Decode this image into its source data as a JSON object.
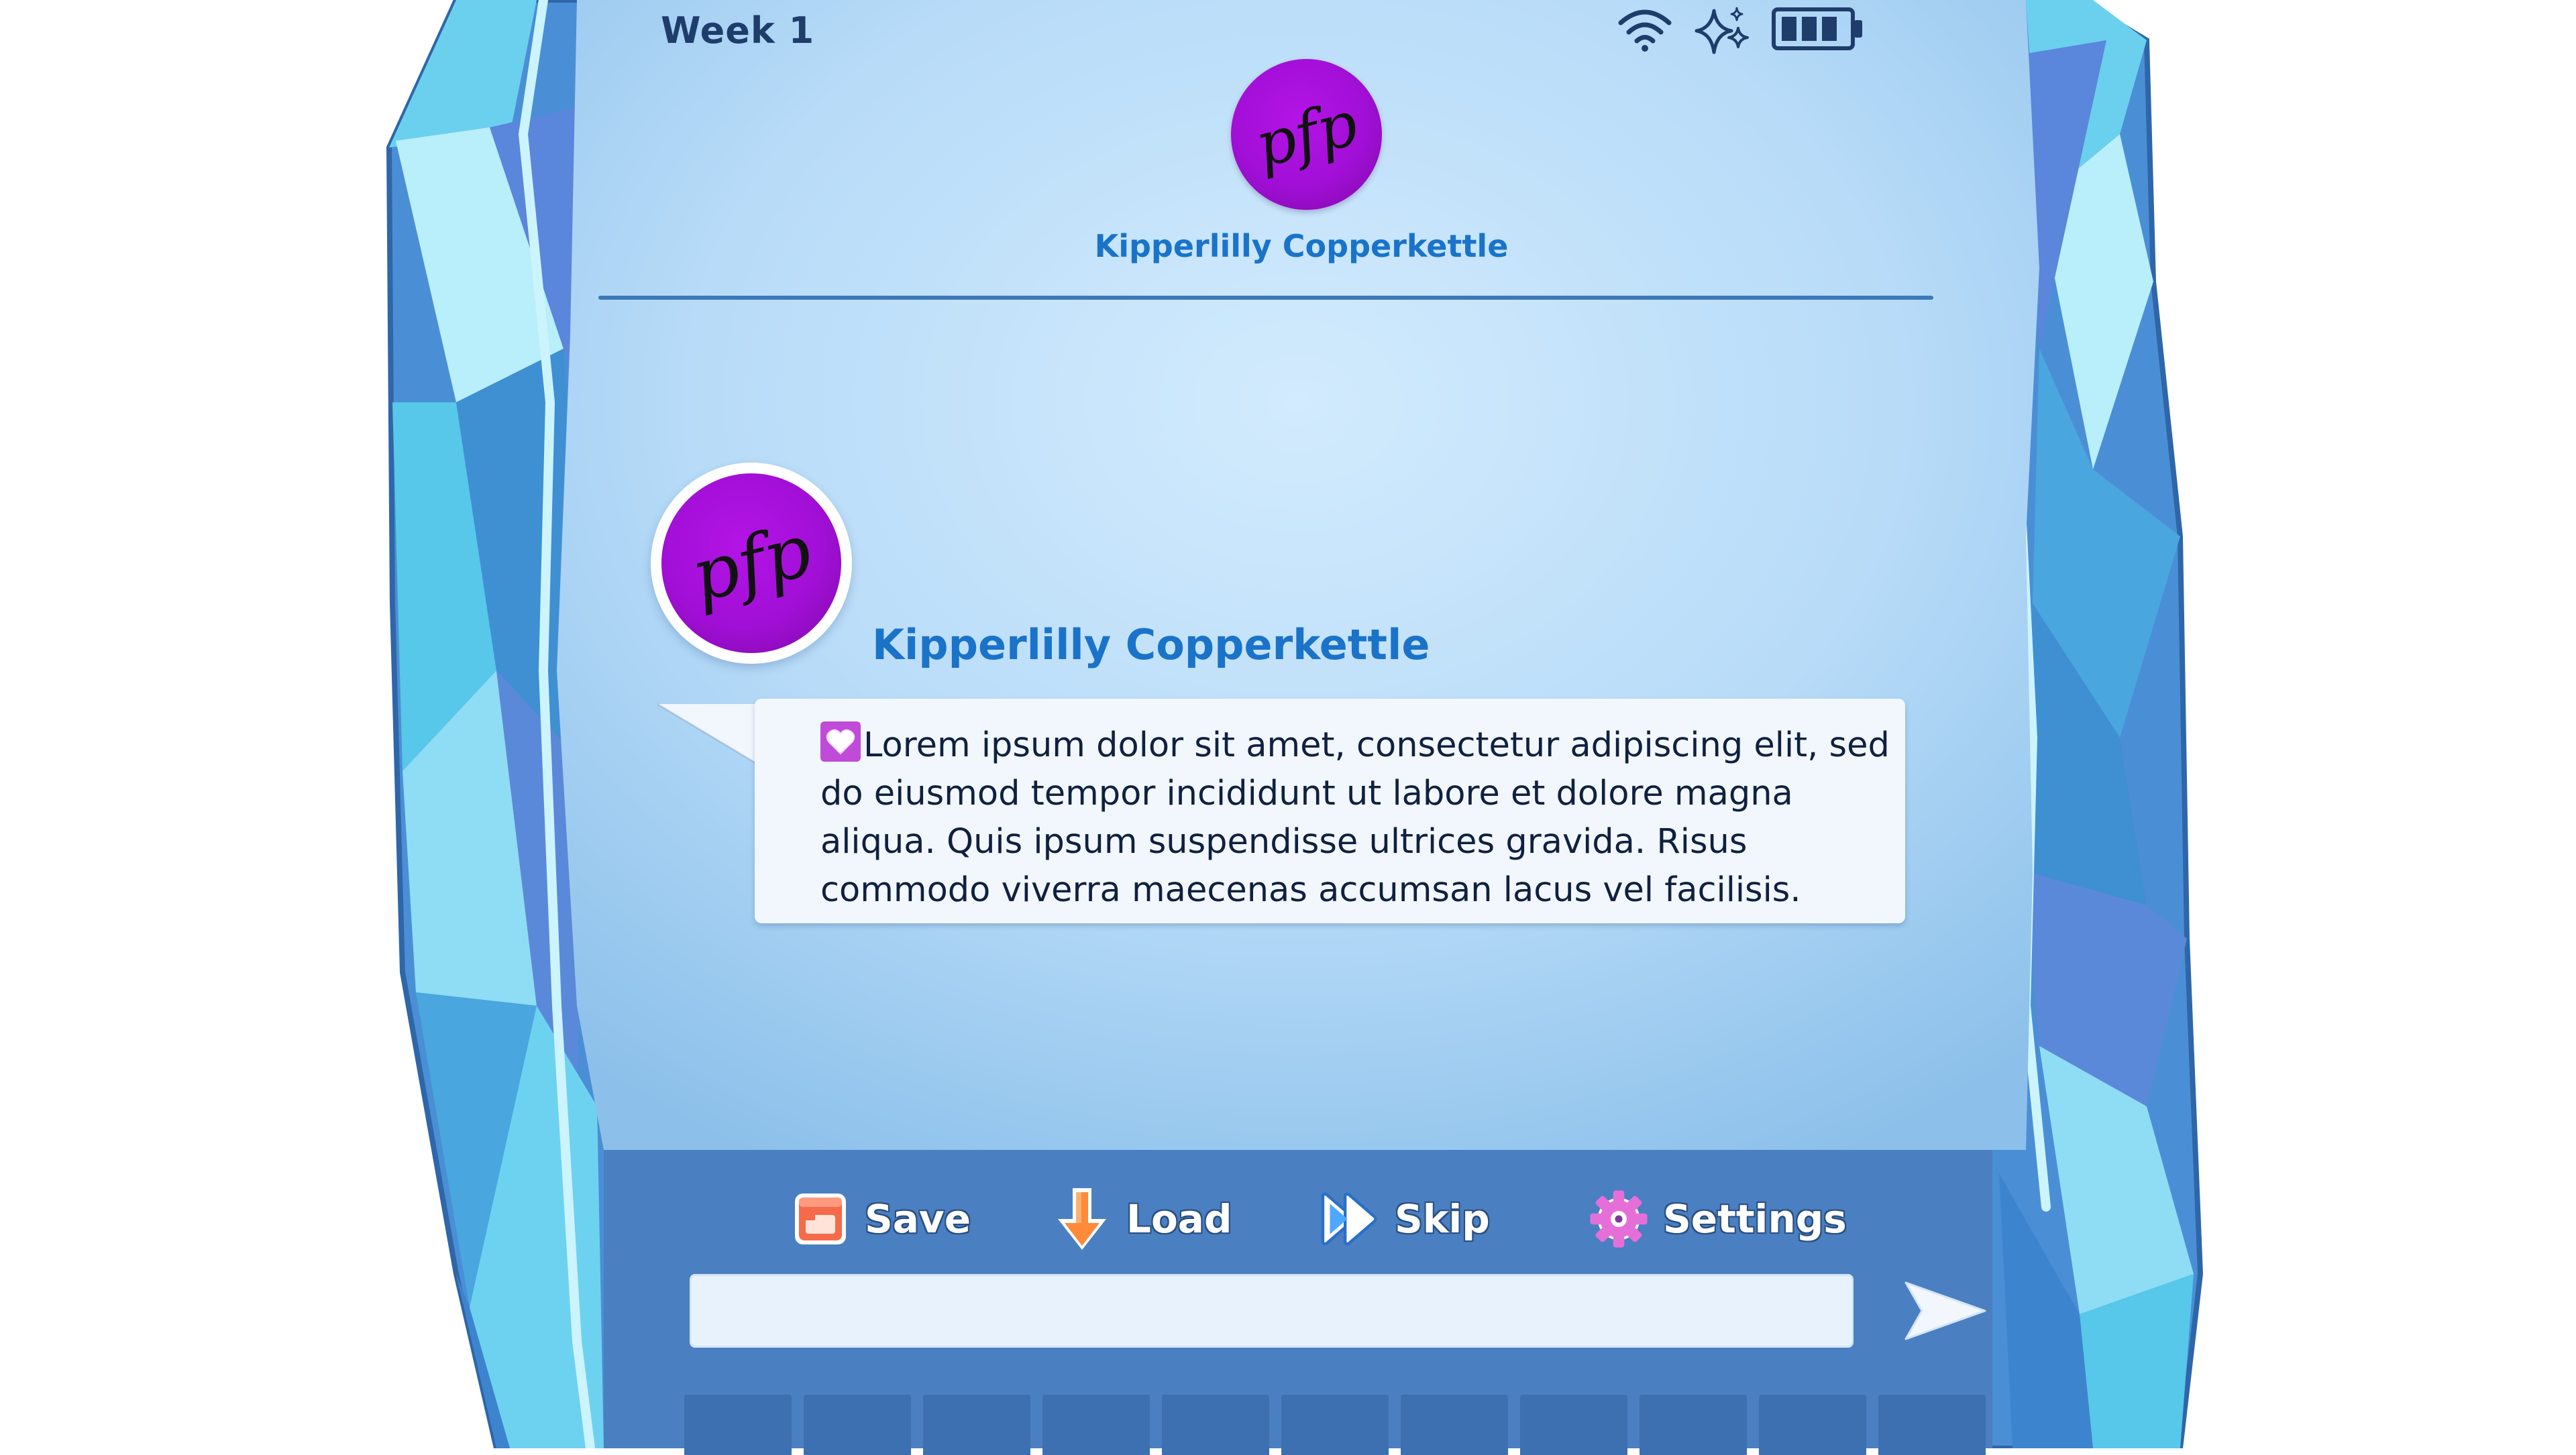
{
  "status_bar": {
    "week_label": "Week 1",
    "icons": [
      "wifi-icon",
      "sparkle-icon",
      "battery-icon"
    ]
  },
  "header": {
    "avatar_text": "pfp",
    "contact_name": "Kipperlilly Copperkettle"
  },
  "message": {
    "avatar_text": "pfp",
    "sender_name": "Kipperlilly Copperkettle",
    "emoji": "heart-emoji",
    "text": "Lorem ipsum dolor sit amet, consectetur adipiscing elit, sed do eiusmod tempor incididunt ut labore et dolore magna aliqua. Quis ipsum suspendisse ultrices gravida. Risus commodo viverra maecenas accumsan lacus vel facilisis."
  },
  "actions": {
    "save_label": "Save",
    "load_label": "Load",
    "skip_label": "Skip",
    "settings_label": "Settings"
  },
  "input": {
    "value": "",
    "placeholder": ""
  },
  "colors": {
    "accent_name": "#1a73c9",
    "toolbar": "#4a7fc1",
    "avatar": "#a10fd6",
    "screen_light": "#cfe8fb",
    "screen_dark": "#8fc3ec"
  }
}
